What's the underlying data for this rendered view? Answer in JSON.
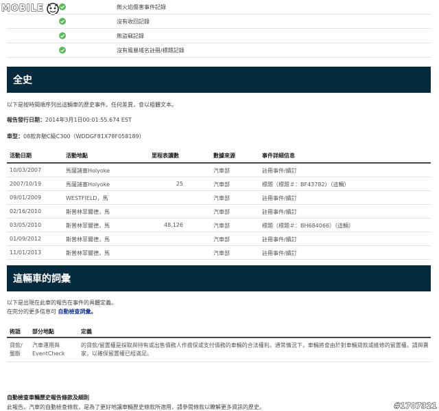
{
  "logo": {
    "text": "MOBILE"
  },
  "top_checks": [
    {
      "label": "無火焰傷害事件記錄"
    },
    {
      "label": "沒有收回記錄"
    },
    {
      "label": "無盜竊記錄"
    },
    {
      "label": "沒有風暴域名註冊/標題記錄"
    }
  ],
  "history": {
    "heading": "全史",
    "intro": "以下是按時間順序列出這輛車的歷史事件。任何差異，會以粗體文本。",
    "report_date_label": "報告發行日期：",
    "report_date_value": "2014年3月1日00:01:55.674 EST",
    "model_label": "車型：",
    "model_value": "08款奔馳C級C300（WDDGF81X78F058189）",
    "columns": [
      "活動日期",
      "活動地點",
      "里程表讀數",
      "數據來源",
      "事件詳細信息"
    ],
    "rows": [
      {
        "date": "10/03/2007",
        "location": "馬薩諸塞Holyoke",
        "odometer": "",
        "source": "汽車部",
        "details": "註冊事件/續訂"
      },
      {
        "date": "2007/10/19",
        "location": "馬薩諸塞Holyoke",
        "odometer": "25",
        "source": "汽車部",
        "details": "標題（標題＃：BF43782）（這輛）"
      },
      {
        "date": "09/01/2009",
        "location": "WESTFIELD，馬",
        "odometer": "",
        "source": "汽車部",
        "details": "註冊事件/續訂"
      },
      {
        "date": "02/16/2010",
        "location": "斯普林菲爾德，馬",
        "odometer": "",
        "source": "汽車部",
        "details": "註冊事件/續訂"
      },
      {
        "date": "03/05/2010",
        "location": "斯普林菲爾德，馬",
        "odometer": "48,126",
        "source": "汽車部",
        "details": "標題（標題＃：BH684066）（這輛）"
      },
      {
        "date": "01/09/2012",
        "location": "斯普林菲爾德，馬",
        "odometer": "",
        "source": "汽車部",
        "details": "註冊事件/續訂"
      },
      {
        "date": "11/01/2013",
        "location": "斯普林菲爾德，馬",
        "odometer": "",
        "source": "汽車部",
        "details": "註冊事件/續訂"
      }
    ]
  },
  "glossary": {
    "heading": "這輛車的詞彙",
    "intro_1": "以下是出現在此車的報告在事件的具體定義。",
    "intro_2_prefix": "在完分的更多信息可",
    "intro_2_link": "自動檢查詞彙。",
    "columns": [
      "術語",
      "部分地點",
      "定義"
    ],
    "rows": [
      {
        "term_line1": "貸款/",
        "term_line2": "壟斷",
        "section_line1": "汽車運用與",
        "section_line2": "EventCheck",
        "definition": "的貸款/留置權是採取與持有或出售債務人作擔保或支付債務的車輛的合法權利。通常情況下，車輛將會由於對車輛貸款或維修的留置權。請與賣家，以確保留置權已經滿足。"
      }
    ]
  },
  "footer": {
    "title": "自動檢查車輛歷史報告條款及細則",
    "clipped_line": "此報告。汽車的自動檢查條款，是為了更好地讓車輛歷史條款所適用，請參閱條款以瞭解更多資訊的歷史。"
  },
  "watermark": "#1707321",
  "colors": {
    "band": "#062a3e",
    "check": "#5cb85c",
    "link": "#1a3a9a"
  }
}
